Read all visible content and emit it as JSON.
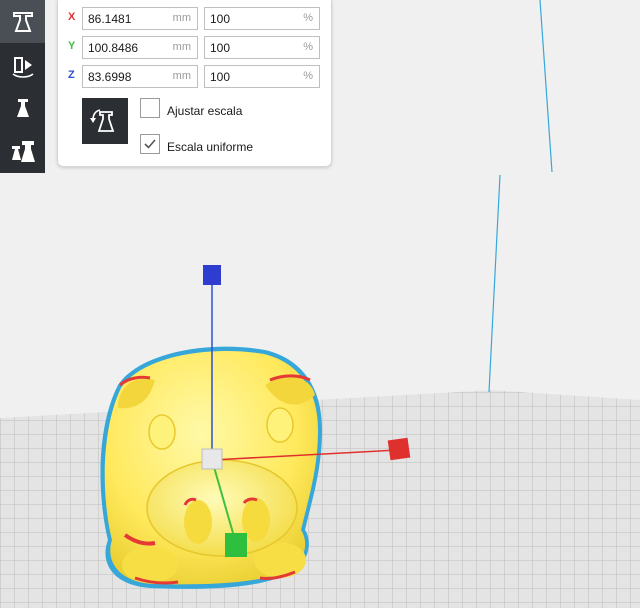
{
  "toolbar": {
    "tools": [
      {
        "icon": "scale-tool-icon",
        "active": true
      },
      {
        "icon": "mirror-tool-icon",
        "active": false
      },
      {
        "icon": "per-model-settings-icon",
        "active": false
      },
      {
        "icon": "support-blocker-icon",
        "active": false
      }
    ]
  },
  "scale_panel": {
    "x": {
      "axis": "X",
      "mm": "86.1481",
      "pct": "100",
      "color": "#e0302e"
    },
    "y": {
      "axis": "Y",
      "mm": "100.8486",
      "pct": "100",
      "color": "#3fbf3f"
    },
    "z": {
      "axis": "Z",
      "mm": "83.6998",
      "pct": "100",
      "color": "#2e4fcf"
    },
    "mm_unit": "mm",
    "pct_unit": "%",
    "snap_icon": "lay-flat-icon",
    "fit_label": "Ajustar escala",
    "fit_checked": false,
    "uniform_label": "Escala uniforme",
    "uniform_checked": true
  },
  "colors": {
    "accent": "#37a7d9",
    "model": "#fff176",
    "overhang": "#e53935",
    "toolbar_bg": "#2b2f33"
  }
}
